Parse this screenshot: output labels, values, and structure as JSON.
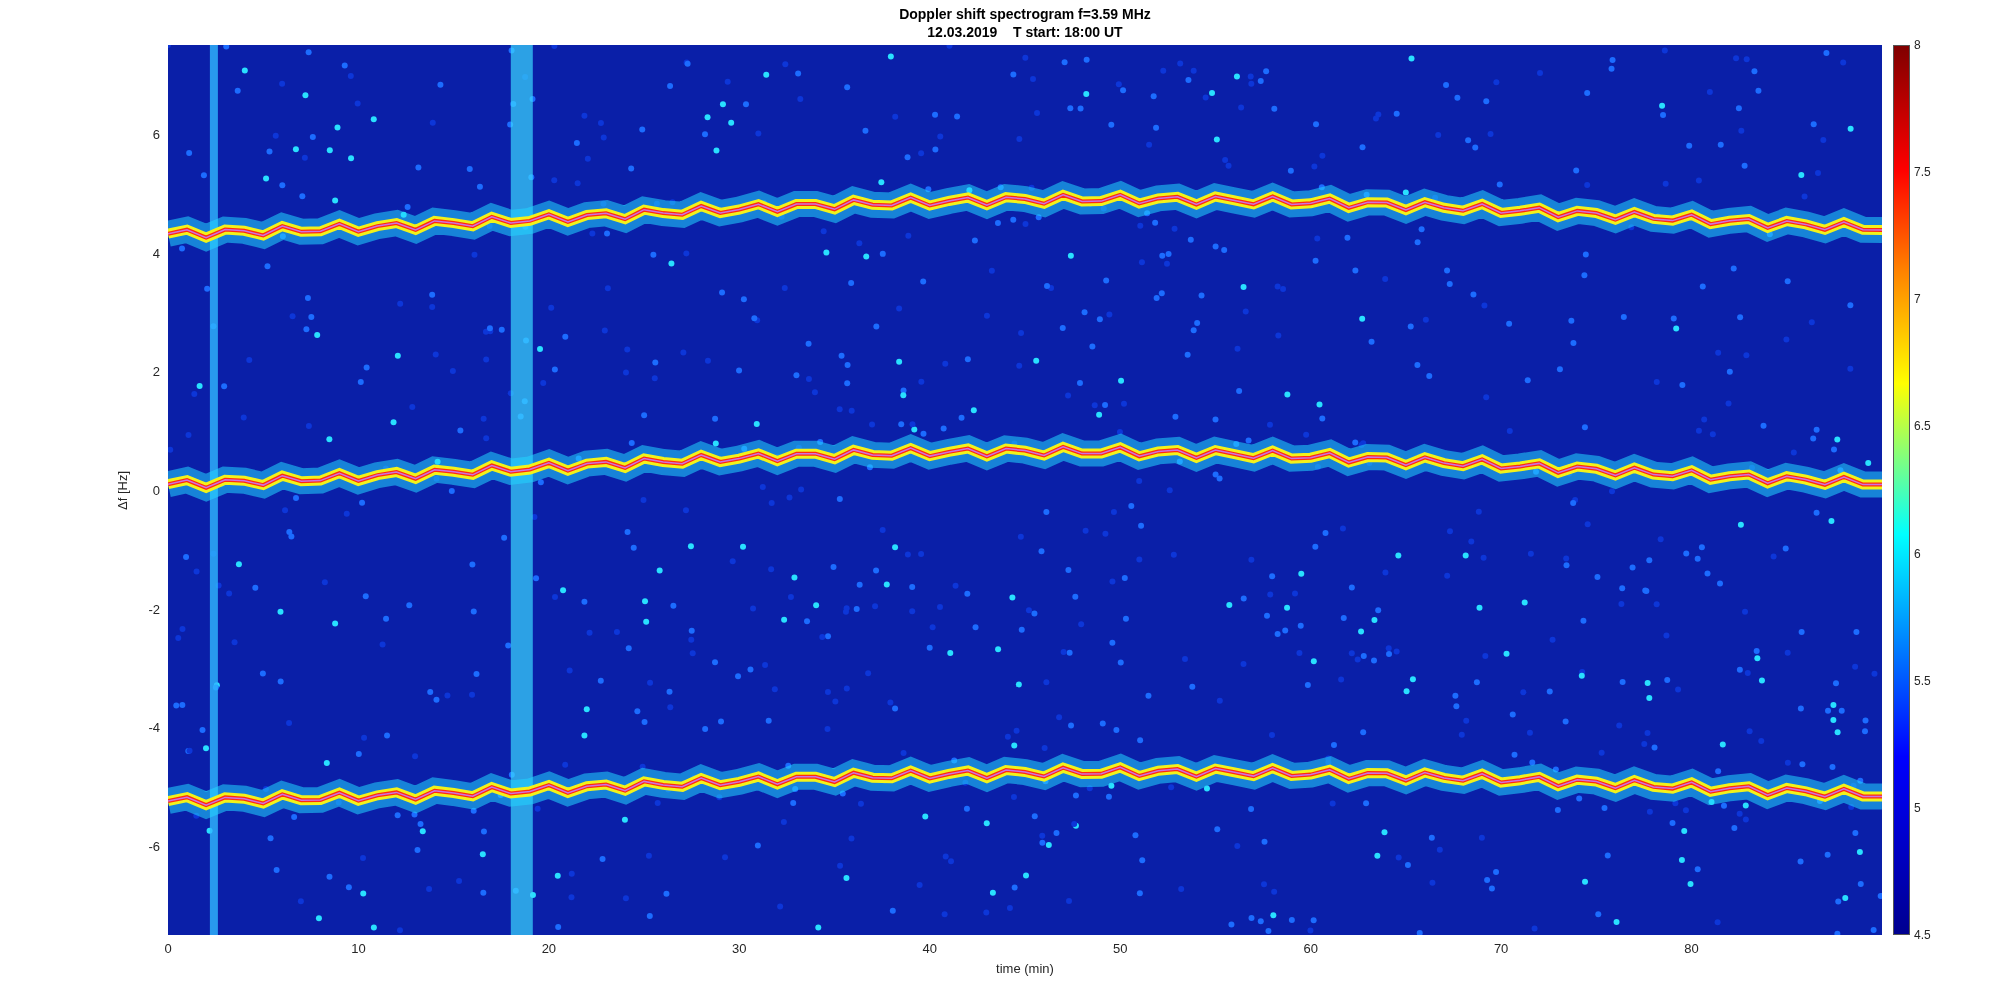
{
  "figure": {
    "title_lines": [
      "Doppler shift spectrogram f=3.59 MHz",
      "12.03.2019    T start: 18:00 UT"
    ],
    "ylabel": "Δf [Hz]",
    "yticks": [
      "6",
      "4",
      "2",
      "0",
      "-2",
      "-4",
      "-6"
    ],
    "xticks": [
      "0",
      "10",
      "20",
      "30",
      "40",
      "50",
      "60",
      "70",
      "80"
    ],
    "xlabel": "time (min)",
    "colorbar": {
      "ticks": [
        "8",
        "7.5",
        "7",
        "6.5",
        "6",
        "5.5",
        "5",
        "4.5"
      ]
    }
  }
}
